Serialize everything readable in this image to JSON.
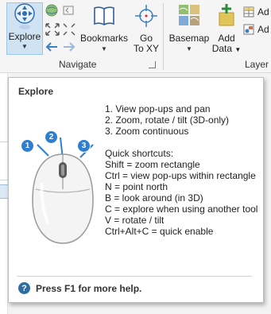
{
  "ribbon": {
    "explore": {
      "label": "Explore"
    },
    "bookmarks": {
      "label": "Bookmarks"
    },
    "goto": {
      "label_line1": "Go",
      "label_line2": "To XY"
    },
    "navigate_group": "Navigate",
    "basemap": {
      "label": "Basemap"
    },
    "add_data": {
      "label_line1": "Add",
      "label_line2": "Data"
    },
    "layer_group": "Layer",
    "add_top": "Ad",
    "add_bottom": "Ad"
  },
  "tooltip": {
    "title": "Explore",
    "lines": [
      "1. View pop-ups and pan",
      "2. Zoom, rotate / tilt (3D-only)",
      "3. Zoom continuous"
    ],
    "shortcuts_heading": "Quick shortcuts:",
    "shortcuts": [
      "Shift = zoom rectangle",
      "Ctrl = view pop-ups within rectangle",
      "N = point north",
      "B = look around (in 3D)",
      "C = explore when using another tool",
      "V = rotate / tilt",
      "Ctrl+Alt+C = quick enable"
    ],
    "mouse_callouts": [
      "1",
      "2",
      "3"
    ],
    "help_icon": "?",
    "footer": "Press F1 for more help."
  },
  "colors": {
    "callout_blue": "#2f7fd0",
    "selected_tool_bg": "#cfe3f3",
    "help_blue": "#2e6da4"
  }
}
